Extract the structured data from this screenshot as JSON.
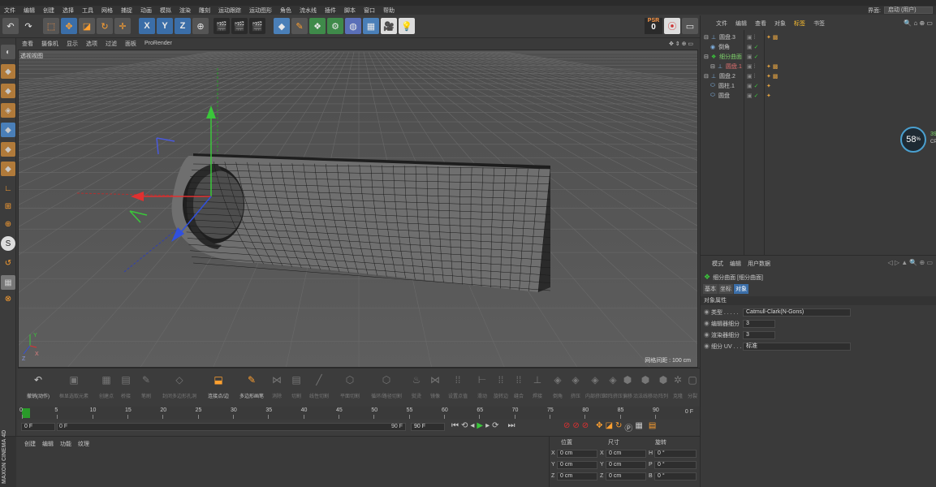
{
  "menubar": [
    "文件",
    "编辑",
    "创建",
    "选择",
    "工具",
    "网格",
    "捕捉",
    "动画",
    "模拟",
    "渲染",
    "雕刻",
    "运动跟踪",
    "运动图形",
    "角色",
    "流水线",
    "插件",
    "脚本",
    "窗口",
    "帮助"
  ],
  "interface": {
    "label": "界面:",
    "value": "启动 (用户)"
  },
  "toolbar": {
    "psr_label": "PSR",
    "psr_value": "0"
  },
  "viewport": {
    "menu": [
      "查看",
      "摄像机",
      "显示",
      "选项",
      "过滤",
      "面板",
      "ProRender"
    ],
    "label": "透视视图",
    "grid_label": "网格间距 : 100 cm"
  },
  "objects": {
    "tabs": [
      "文件",
      "编辑",
      "查看",
      "对象",
      "标签",
      "书签"
    ],
    "items": [
      {
        "name": "圆盘.3",
        "color": "#c8c8c8",
        "icon": "line-icon"
      },
      {
        "name": "倒角",
        "color": "#c8c8c8",
        "icon": "bevel-icon"
      },
      {
        "name": "细分曲面",
        "color": "#7fd36b",
        "icon": "subdivision-icon"
      },
      {
        "name": "圆盘.1",
        "color": "#e07070",
        "icon": "line-icon"
      },
      {
        "name": "圆盘.2",
        "color": "#c8c8c8",
        "icon": "line-icon"
      },
      {
        "name": "圆柱.1",
        "color": "#c8c8c8",
        "icon": "cylinder-icon"
      },
      {
        "name": "圆盘",
        "color": "#c8c8c8",
        "icon": "cylinder-icon"
      }
    ]
  },
  "cpu": {
    "percent": "58",
    "unit": "%",
    "side_value": "39",
    "side_label": "CP"
  },
  "attributes": {
    "tabs": [
      "模式",
      "编辑",
      "用户数据"
    ],
    "title": "细分曲面 [细分曲面]",
    "subtabs": [
      "基本",
      "坐标",
      "对象"
    ],
    "section": "对象属性",
    "props": [
      {
        "label": "类型 . . . . .",
        "value": "Catmull-Clark(N-Gons)"
      },
      {
        "label": "编辑器细分",
        "value": "3"
      },
      {
        "label": "渲染器细分",
        "value": "3"
      },
      {
        "label": "细分 UV . . .",
        "value": "标准"
      }
    ]
  },
  "bottom_tools": [
    {
      "label": "撤销(动作)",
      "icon": "undo-icon"
    },
    {
      "label": "框显选取元素",
      "icon": "frame-icon"
    },
    {
      "label": "创建点",
      "icon": "point-icon"
    },
    {
      "label": "桥接",
      "icon": "bridge-icon"
    },
    {
      "label": "笔刷",
      "icon": "brush-icon"
    },
    {
      "label": "封闭多边形孔洞",
      "icon": "close-hole-icon"
    },
    {
      "label": "连接点/边",
      "icon": "connect-icon"
    },
    {
      "label": "多边形画笔",
      "icon": "poly-pen-icon"
    },
    {
      "label": "消除",
      "icon": "dissolve-icon"
    },
    {
      "label": "切割",
      "icon": "cut-icon"
    },
    {
      "label": "线性切割",
      "icon": "line-cut-icon"
    },
    {
      "label": "平面切割",
      "icon": "plane-cut-icon"
    },
    {
      "label": "循环/路径切割",
      "icon": "loop-cut-icon"
    },
    {
      "label": "熨烫",
      "icon": "iron-icon"
    },
    {
      "label": "镜像",
      "icon": "mirror-icon"
    },
    {
      "label": "设置点值",
      "icon": "set-value-icon"
    },
    {
      "label": "滑动",
      "icon": "slide-icon"
    },
    {
      "label": "旋转边",
      "icon": "spin-edge-icon"
    },
    {
      "label": "缝合",
      "icon": "stitch-icon"
    },
    {
      "label": "焊接",
      "icon": "weld-icon"
    },
    {
      "label": "倒角",
      "icon": "bevel-tool-icon"
    },
    {
      "label": "挤压",
      "icon": "extrude-icon"
    },
    {
      "label": "内部挤压",
      "icon": "inner-extrude-icon"
    },
    {
      "label": "矩阵挤压",
      "icon": "matrix-extrude-icon"
    },
    {
      "label": "偏移",
      "icon": "offset-icon"
    },
    {
      "label": "沿法线移动",
      "icon": "normal-move-icon"
    },
    {
      "label": "阵列",
      "icon": "array-icon"
    },
    {
      "label": "克隆",
      "icon": "clone-icon"
    },
    {
      "label": "断开连接",
      "icon": "disconnect-icon"
    },
    {
      "label": "融解",
      "icon": "melt-icon"
    },
    {
      "label": "优化",
      "icon": "optimize-icon"
    },
    {
      "label": "分裂",
      "icon": "split-icon"
    }
  ],
  "timeline": {
    "ticks": [
      "0",
      "5",
      "10",
      "15",
      "20",
      "25",
      "30",
      "35",
      "40",
      "45",
      "50",
      "55",
      "60",
      "65",
      "70",
      "75",
      "80",
      "85",
      "90"
    ],
    "end_label": "0 F"
  },
  "playbar": {
    "start": "0 F",
    "range_start": "0 F",
    "range_end": "90 F",
    "end": "90 F"
  },
  "materials": {
    "tabs": [
      "创建",
      "编辑",
      "功能",
      "纹理"
    ],
    "logo": "MAXON CINEMA 4D"
  },
  "coords": {
    "headers": [
      "位置",
      "尺寸",
      "旋转"
    ],
    "rows": [
      {
        "a": "X",
        "av": "0 cm",
        "b": "X",
        "bv": "0 cm",
        "c": "H",
        "cv": "0 °"
      },
      {
        "a": "Y",
        "av": "0 cm",
        "b": "Y",
        "bv": "0 cm",
        "c": "P",
        "cv": "0 °"
      },
      {
        "a": "Z",
        "av": "0 cm",
        "b": "Z",
        "bv": "0 cm",
        "c": "B",
        "cv": "0 °"
      }
    ]
  }
}
